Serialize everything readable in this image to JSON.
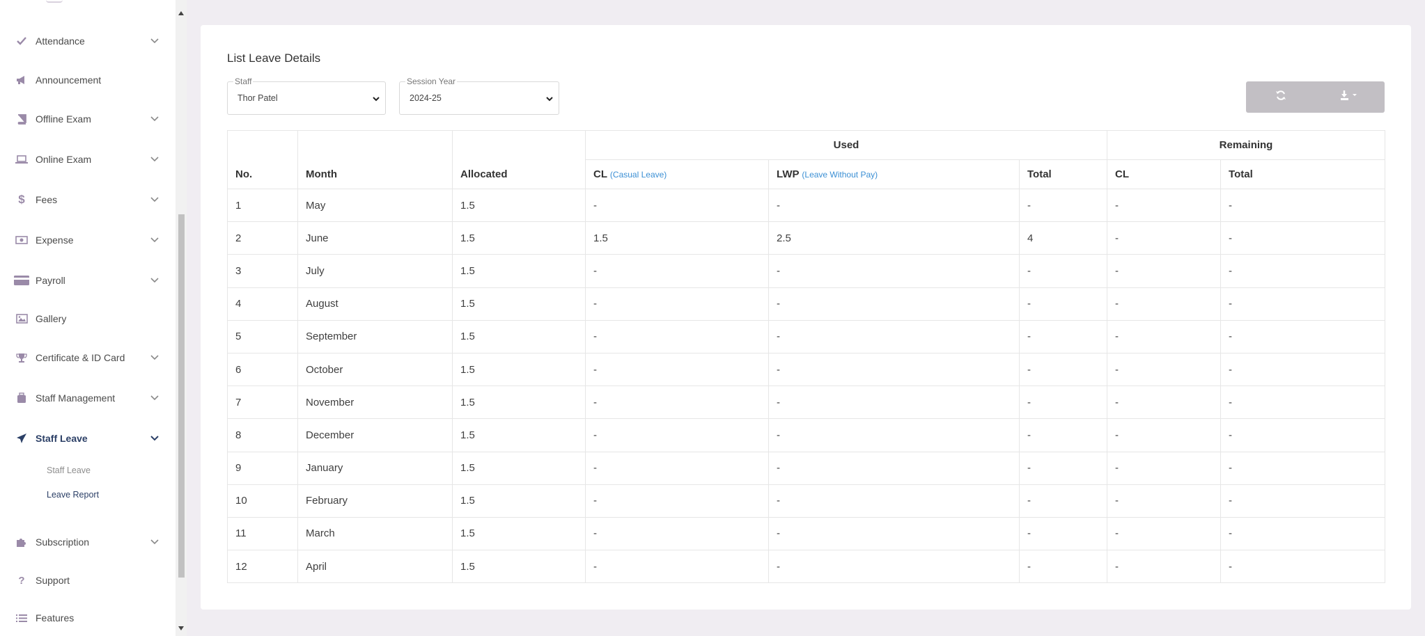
{
  "sidebar": {
    "items": [
      {
        "label": "Attendance",
        "icon": "check-icon",
        "has_chevron": true
      },
      {
        "label": "Announcement",
        "icon": "megaphone-icon",
        "has_chevron": false
      },
      {
        "label": "Offline Exam",
        "icon": "book-icon",
        "has_chevron": true
      },
      {
        "label": "Online Exam",
        "icon": "laptop-icon",
        "has_chevron": true
      },
      {
        "label": "Fees",
        "icon": "dollar-icon",
        "has_chevron": true
      },
      {
        "label": "Expense",
        "icon": "money-icon",
        "has_chevron": true
      },
      {
        "label": "Payroll",
        "icon": "credit-card-icon",
        "has_chevron": true
      },
      {
        "label": "Gallery",
        "icon": "image-icon",
        "has_chevron": false
      },
      {
        "label": "Certificate & ID Card",
        "icon": "trophy-icon",
        "has_chevron": true
      },
      {
        "label": "Staff Management",
        "icon": "suitcase-icon",
        "has_chevron": true
      },
      {
        "label": "Staff Leave",
        "icon": "plane-icon",
        "has_chevron": true,
        "active": true
      },
      {
        "label": "Subscription",
        "icon": "puzzle-icon",
        "has_chevron": true
      },
      {
        "label": "Support",
        "icon": "question-icon",
        "has_chevron": false
      },
      {
        "label": "Features",
        "icon": "list-icon",
        "has_chevron": false
      }
    ],
    "sub_items": [
      {
        "label": "Staff Leave",
        "active": false
      },
      {
        "label": "Leave Report",
        "active": true
      }
    ]
  },
  "page": {
    "title": "List Leave Details",
    "filters": {
      "staff": {
        "legend": "Staff",
        "value": "Thor Patel"
      },
      "session_year": {
        "legend": "Session Year",
        "value": "2024-25"
      }
    },
    "actions": [
      "refresh-icon",
      "download-icon"
    ]
  },
  "table": {
    "group_headers": {
      "used": "Used",
      "remaining": "Remaining"
    },
    "columns": {
      "no": "No.",
      "month": "Month",
      "allocated": "Allocated",
      "cl": "CL",
      "cl_hint": "(Casual Leave)",
      "lwp": "LWP",
      "lwp_hint": "(Leave Without Pay)",
      "used_total": "Total",
      "rem_cl": "CL",
      "rem_total": "Total"
    },
    "rows": [
      [
        "1",
        "May",
        "1.5",
        "-",
        "-",
        "-",
        "-",
        "-"
      ],
      [
        "2",
        "June",
        "1.5",
        "1.5",
        "2.5",
        "4",
        "-",
        "-"
      ],
      [
        "3",
        "July",
        "1.5",
        "-",
        "-",
        "-",
        "-",
        "-"
      ],
      [
        "4",
        "August",
        "1.5",
        "-",
        "-",
        "-",
        "-",
        "-"
      ],
      [
        "5",
        "September",
        "1.5",
        "-",
        "-",
        "-",
        "-",
        "-"
      ],
      [
        "6",
        "October",
        "1.5",
        "-",
        "-",
        "-",
        "-",
        "-"
      ],
      [
        "7",
        "November",
        "1.5",
        "-",
        "-",
        "-",
        "-",
        "-"
      ],
      [
        "8",
        "December",
        "1.5",
        "-",
        "-",
        "-",
        "-",
        "-"
      ],
      [
        "9",
        "January",
        "1.5",
        "-",
        "-",
        "-",
        "-",
        "-"
      ],
      [
        "10",
        "February",
        "1.5",
        "-",
        "-",
        "-",
        "-",
        "-"
      ],
      [
        "11",
        "March",
        "1.5",
        "-",
        "-",
        "-",
        "-",
        "-"
      ],
      [
        "12",
        "April",
        "1.5",
        "-",
        "-",
        "-",
        "-",
        "-"
      ]
    ]
  },
  "colors": {
    "accent": "#2b3f66",
    "link": "#3b8fd4",
    "button_bg": "#c2bfc4",
    "page_bg": "#f0edf2"
  }
}
